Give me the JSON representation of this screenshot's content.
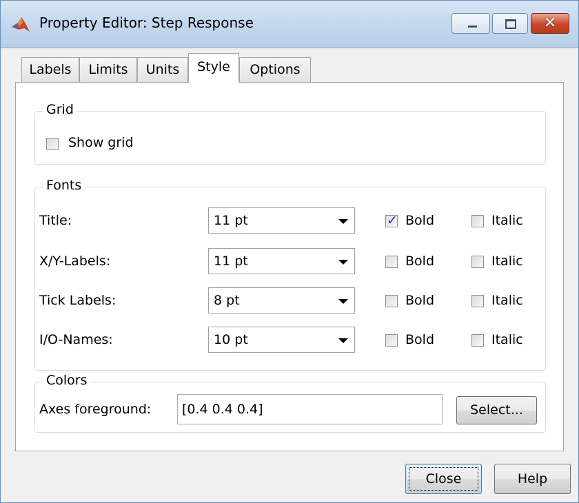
{
  "window": {
    "title": "Property Editor: Step Response",
    "controls": {
      "minimize": "–",
      "maximize": "□",
      "close": "✕"
    },
    "icon": "matlab-logo-icon"
  },
  "tabs": [
    {
      "label": "Labels"
    },
    {
      "label": "Limits"
    },
    {
      "label": "Units"
    },
    {
      "label": "Style",
      "active": true
    },
    {
      "label": "Options"
    }
  ],
  "grid": {
    "title": "Grid",
    "show_grid": {
      "label": "Show grid",
      "checked": false
    }
  },
  "fonts": {
    "title": "Fonts",
    "rows": [
      {
        "label": "Title:",
        "size": "11 pt",
        "bold_label": "Bold",
        "bold": true,
        "italic_label": "Italic",
        "italic": false
      },
      {
        "label": "X/Y-Labels:",
        "size": "11 pt",
        "bold_label": "Bold",
        "bold": false,
        "italic_label": "Italic",
        "italic": false
      },
      {
        "label": "Tick Labels:",
        "size": "8 pt",
        "bold_label": "Bold",
        "bold": false,
        "italic_label": "Italic",
        "italic": false
      },
      {
        "label": "I/O-Names:",
        "size": "10 pt",
        "bold_label": "Bold",
        "bold": false,
        "italic_label": "Italic",
        "italic": false
      }
    ]
  },
  "colors": {
    "title": "Colors",
    "axes_label": "Axes foreground:",
    "axes_value": "[0.4 0.4 0.4]",
    "select_label": "Select..."
  },
  "footer": {
    "close_label": "Close",
    "help_label": "Help"
  },
  "palette": {
    "accent": "#3c7fb1",
    "close_red": "#c8462c",
    "check_blue": "#2b3f8c"
  }
}
